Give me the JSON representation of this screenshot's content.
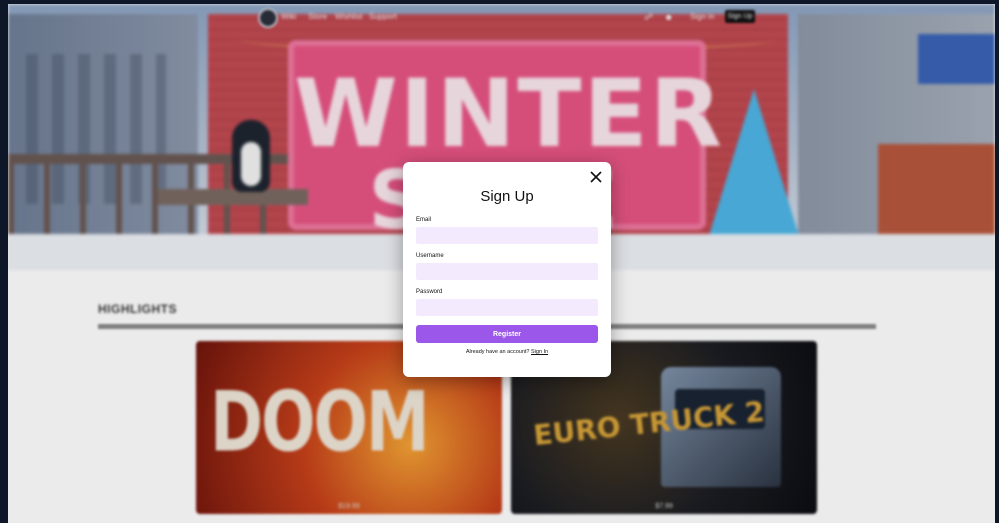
{
  "nav": {
    "links": [
      "Wiki",
      "Store",
      "Wishlist",
      "Support"
    ],
    "cart_icon": "cart-icon",
    "user_icon": "user-icon",
    "sign_in_label": "Sign in",
    "sign_up_label": "Sign Up"
  },
  "hero": {
    "banner_line1": "WINTER",
    "banner_line2": "SALE"
  },
  "highlights": {
    "title": "HIGHLIGHTS",
    "cards": [
      {
        "logo": "DOOM",
        "caption": "$19.99"
      },
      {
        "logo": "EURO TRUCK 2",
        "caption": "$7.99"
      }
    ]
  },
  "modal": {
    "title": "Sign Up",
    "close_icon": "close-icon",
    "fields": {
      "email_label": "Email",
      "email_value": "",
      "username_label": "Username",
      "username_value": "",
      "password_label": "Password",
      "password_value": ""
    },
    "register_label": "Register",
    "signin_prompt": "Already have an account?",
    "signin_link": "Sign In"
  },
  "colors": {
    "accent": "#9b57ea",
    "input_bg": "#f3ebfd",
    "banner_pink": "#e85585"
  }
}
